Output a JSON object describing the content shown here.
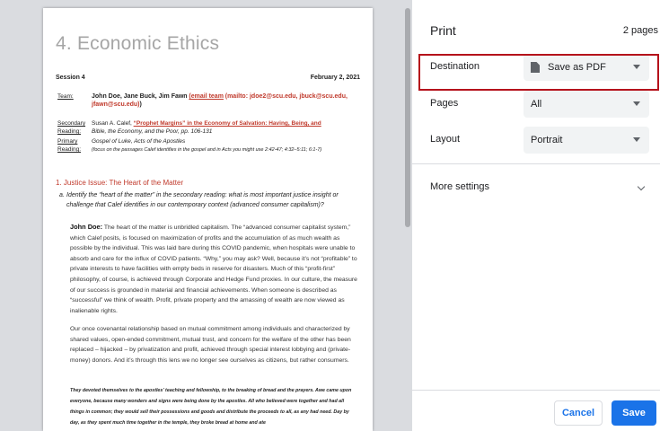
{
  "document": {
    "title": "4. Economic Ethics",
    "session": "Session 4",
    "date": "February 2, 2021",
    "team_label": "Team",
    "team_names": "John Doe, Jane Buck, Jim Fawn",
    "team_link": "(email team",
    "team_mailto": "(mailto: jdoe2@scu.edu, jbuck@scu.edu,",
    "team_mailto2": "jfawn@scu.edu)",
    "team_close": ")",
    "secondary_label": "Secondary",
    "reading_label": "Reading:",
    "secondary_author": "Susan A. Calef, ",
    "secondary_link": "“Prophet Margins” in the Economy of Salvation: Having, Being, and",
    "secondary_book": "Bible, the Economy, and the Poor, pp. 106-131",
    "primary_label": "Primary",
    "primary_reading_label": "Reading:",
    "primary_text": "Gospel of Luke, Acts of the Apostles",
    "primary_note": "(focus on the passages Calef identifies in the gospel and in Acts you might use 2:42-47; 4:32–5:11; 6:1-7)",
    "section_heading": "1. Justice Issue: The Heart of the Matter",
    "question_letter": "a.",
    "question": "Identify the “heart of the matter” in the secondary reading: what is most important justice insight or challenge that Calef identifies in our contemporary context (advanced consumer capitalism)?",
    "para1_name": "John Doe:",
    "para1": "  The heart of the matter is unbridled capitalism.  The “advanced consumer capitalist system,” which Calef posits, is focused on maximization of profits and the accumulation of as much wealth as possible by the individual.  This was laid bare during this COVID pandemic, when hospitals were unable to absorb and care for the influx of COVID patients.  “Why,” you may ask?  Well, because it’s not “profitable” to private interests to have facilities with empty beds in reserve for disasters.  Much of this “profit-first” philosophy, of course, is achieved through Corporate and Hedge Fund proxies.  In our culture, the measure of our success is grounded in material and financial achievements.  When someone is described as “successful” we think of wealth.  Profit, private property and the amassing of wealth are now viewed as inalienable rights.",
    "para2": "Our once covenantal relationship based on mutual commitment among individuals and characterized by shared values, open-ended commitment, mutual trust, and concern for the welfare of the other has been replaced – hijacked – by privatization and profit, achieved through special interest lobbying and (private-money) donors.  And it’s through this lens we no longer see ourselves as citizens, but rather consumers.",
    "para3": "They devoted themselves to the apostles' teaching and fellowship, to the breaking of bread and the prayers.  Awe came upon everyone, because many wonders and signs were being done by the apostles.  All who believed were together and had all things in common; they would sell their possessions and goods and distribute the proceeds to all, as any had need.  Day by day, as they spent much time together in the temple, they broke bread at home and ate"
  },
  "panel": {
    "title": "Print",
    "page_count": "2 pages",
    "destination_label": "Destination",
    "destination_value": "Save as PDF",
    "pages_label": "Pages",
    "pages_value": "All",
    "layout_label": "Layout",
    "layout_value": "Portrait",
    "more_settings": "More settings",
    "cancel": "Cancel",
    "save": "Save"
  },
  "colors": {
    "accent": "#1a73e8",
    "highlight_border": "#b5121b",
    "link_red": "#c0392b"
  }
}
